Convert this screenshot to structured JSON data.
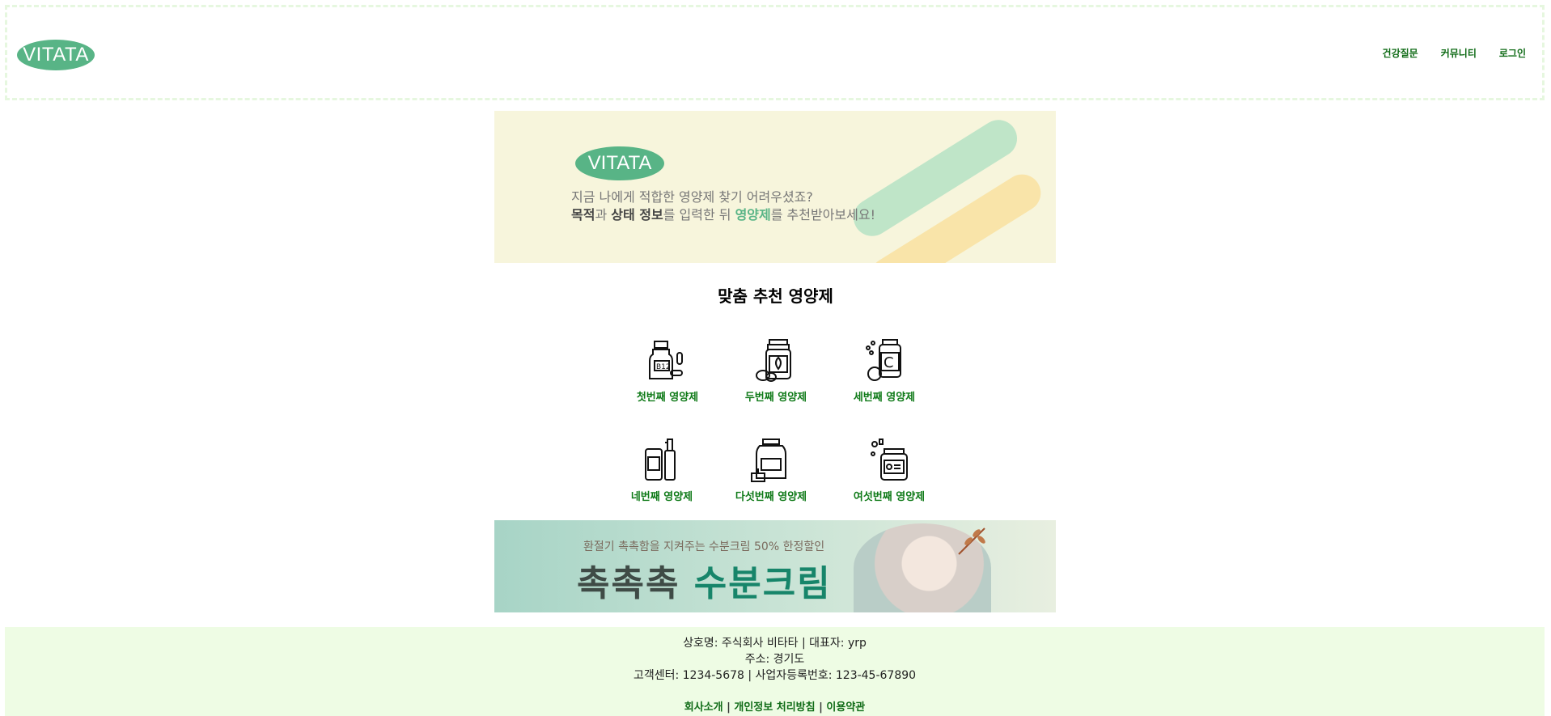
{
  "header": {
    "logo_text": "VITATA",
    "nav": [
      "건강질문",
      "커뮤니티",
      "로그인"
    ]
  },
  "hero": {
    "logo_text": "VITATA",
    "line1": "지금 나에게 적합한 영양제 찾기 어려우셨죠?",
    "line2_parts": [
      "목적",
      "과 ",
      "상태 정보",
      "를 입력한 뒤 ",
      "영양제",
      "를 추천받아보세요!"
    ]
  },
  "section": {
    "title": "맞춤 추천 영양제",
    "items": [
      {
        "label": "첫번째 영양제",
        "icon": "b12-bottle-icon"
      },
      {
        "label": "두번째 영양제",
        "icon": "herbal-jar-icon"
      },
      {
        "label": "세번째 영양제",
        "icon": "vitamin-c-icon"
      },
      {
        "label": "네번째 영양제",
        "icon": "spray-bottle-icon"
      },
      {
        "label": "다섯번째 영양제",
        "icon": "protein-jar-icon"
      },
      {
        "label": "여섯번째 영양제",
        "icon": "pill-jar-icon"
      }
    ]
  },
  "promo": {
    "subtitle": "환절기 촉촉함을 지켜주는 수분크림 50% 한정할인",
    "title_a": "촉촉촉 ",
    "title_b": "수분크림"
  },
  "footer": {
    "line1": "상호명: 주식회사 비타타 | 대표자: yrp",
    "line2": "주소: 경기도",
    "line3": "고객센터: 1234-5678 | 사업자등록번호: 123-45-67890",
    "links": [
      "회사소개",
      "개인정보 처리방침",
      "이용약관"
    ],
    "separator": " | "
  },
  "colors": {
    "brand": "#58b486",
    "nav": "#0f6b16",
    "footer_bg": "#eefce4"
  }
}
